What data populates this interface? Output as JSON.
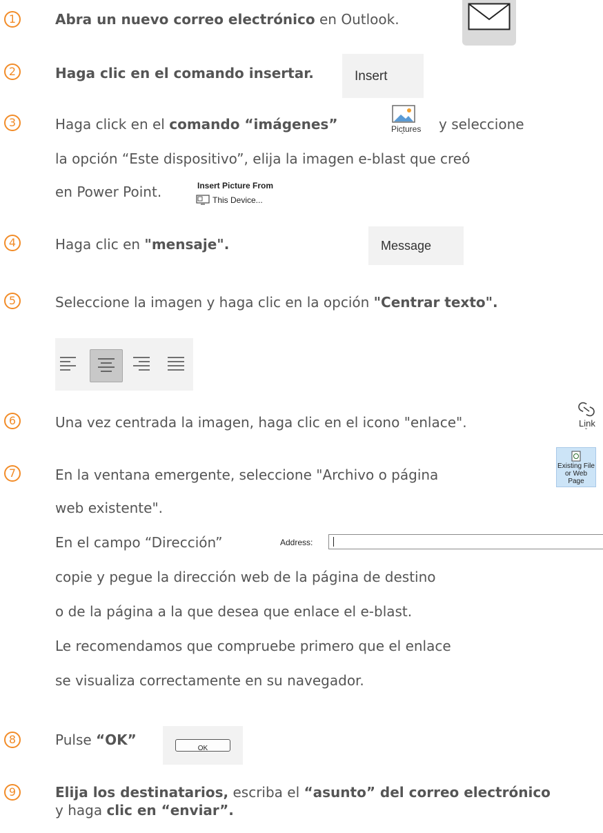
{
  "colors": {
    "accent": "#f28c28",
    "text": "#555555"
  },
  "steps": [
    {
      "num": "1",
      "lines": [
        [
          {
            "t": "Abra un nuevo correo electrónico",
            "b": true
          },
          {
            "t": " en Outlook.",
            "b": false
          }
        ]
      ]
    },
    {
      "num": "2",
      "lines": [
        [
          {
            "t": "Haga clic en el comando insertar.",
            "b": true
          }
        ]
      ]
    },
    {
      "num": "3",
      "lines": [
        [
          {
            "t": "Haga click en el ",
            "b": false
          },
          {
            "t": "comando “imágenes”",
            "b": true
          }
        ],
        [
          {
            "t": "y seleccione",
            "b": false
          }
        ],
        [
          {
            "t": "la opción “Este dispositivo”, elija la imagen e-blast que creó",
            "b": false
          }
        ],
        [
          {
            "t": "en Power Point.",
            "b": false
          }
        ]
      ]
    },
    {
      "num": "4",
      "lines": [
        [
          {
            "t": "Haga clic en ",
            "b": false
          },
          {
            "t": "\"mensaje\".",
            "b": true
          }
        ]
      ]
    },
    {
      "num": "5",
      "lines": [
        [
          {
            "t": "Seleccione la imagen y haga clic en la opción ",
            "b": false
          },
          {
            "t": "\"Centrar texto\".",
            "b": true
          }
        ]
      ]
    },
    {
      "num": "6",
      "lines": [
        [
          {
            "t": "Una vez centrada la imagen, haga clic en el icono \"enlace\".",
            "b": false
          }
        ]
      ]
    },
    {
      "num": "7",
      "lines": [
        [
          {
            "t": "En la ventana emergente, seleccione \"Archivo o página",
            "b": false
          }
        ],
        [
          {
            "t": "web existente\".",
            "b": false
          }
        ],
        [
          {
            "t": "En el campo “Dirección”",
            "b": false
          }
        ],
        [
          {
            "t": "copie y pegue la dirección web de la página de destino",
            "b": false
          }
        ],
        [
          {
            "t": "o de la página a la que desea que enlace el e-blast.",
            "b": false
          }
        ],
        [
          {
            "t": "Le recomendamos que compruebe primero que el enlace",
            "b": false
          }
        ],
        [
          {
            "t": "se visualiza correctamente en su navegador.",
            "b": false
          }
        ]
      ]
    },
    {
      "num": "8",
      "lines": [
        [
          {
            "t": "Pulse ",
            "b": false
          },
          {
            "t": "“OK”",
            "b": true
          }
        ]
      ]
    },
    {
      "num": "9",
      "lines": [
        [
          {
            "t": "Elija los destinatarios,",
            "b": true
          },
          {
            "t": " escriba el ",
            "b": false
          },
          {
            "t": "“asunto” del correo electrónico",
            "b": true
          }
        ],
        [
          {
            "t": "y haga ",
            "b": false
          },
          {
            "t": "clic en “enviar”.",
            "b": true
          }
        ]
      ]
    }
  ],
  "ui": {
    "insert_label": "Insert",
    "pictures_label": "Pictures",
    "insert_picture_from": "Insert Picture From",
    "this_device": "This Device...",
    "message_label": "Message",
    "link_label": "Link",
    "existing_file_line1": "Existing File",
    "existing_file_line2": "or Web Page",
    "address_label": "Address:",
    "ok_label": "OK"
  }
}
